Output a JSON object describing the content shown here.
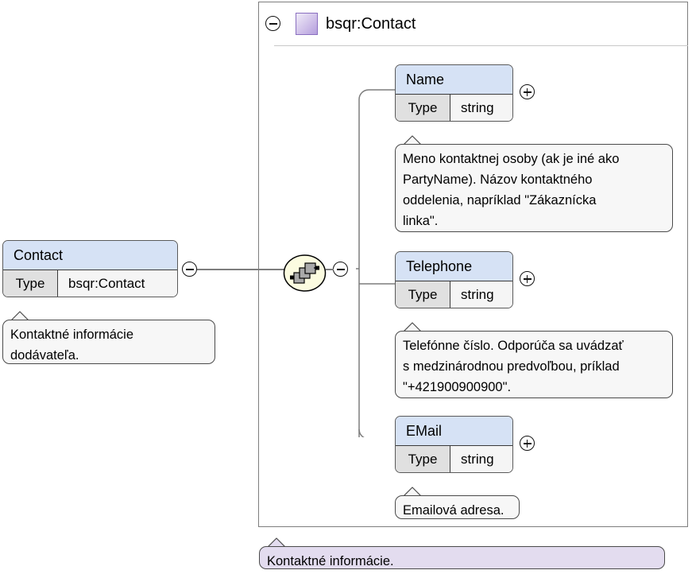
{
  "diagram": {
    "type": "xml-schema-element-diagram",
    "root": {
      "title": "bsqr:Contact",
      "namespace_swatch_color": "#b49fdd",
      "expander": "minus",
      "annotation": "Kontaktné informácie."
    },
    "source_element": {
      "name": "Contact",
      "type_label": "Type",
      "type_value": "bsqr:Contact",
      "expander": "minus",
      "annotation": "Kontaktné informácie\ndodávateľa."
    },
    "compositor": {
      "kind": "sequence",
      "expander": "minus"
    },
    "children": [
      {
        "name": "Name",
        "type_label": "Type",
        "type_value": "string",
        "expander": "plus",
        "annotation": "Meno kontaktnej osoby (ak je iné ako\nPartyName). Názov kontaktného\noddelenia, napríklad \"Zákaznícka\nlinka\"."
      },
      {
        "name": "Telephone",
        "type_label": "Type",
        "type_value": "string",
        "expander": "plus",
        "annotation": "Telefónne číslo. Odporúča sa uvádzať\ns medzinárodnou predvoľbou, príklad\n\"+421900900900\"."
      },
      {
        "name": "EMail",
        "type_label": "Type",
        "type_value": "string",
        "expander": "plus",
        "annotation": "Emailová adresa."
      }
    ],
    "colors": {
      "element_header": "#d6e2f5",
      "type_cell": "#e0e0e0",
      "value_cell": "#f5f5f5",
      "annotation_bg": "#f7f7f7",
      "root_annotation_bg": "#e3dcef",
      "border": "#5a5a5a",
      "connector": "#7d7d7d",
      "compositor_fill": "#fbfbe0"
    }
  }
}
